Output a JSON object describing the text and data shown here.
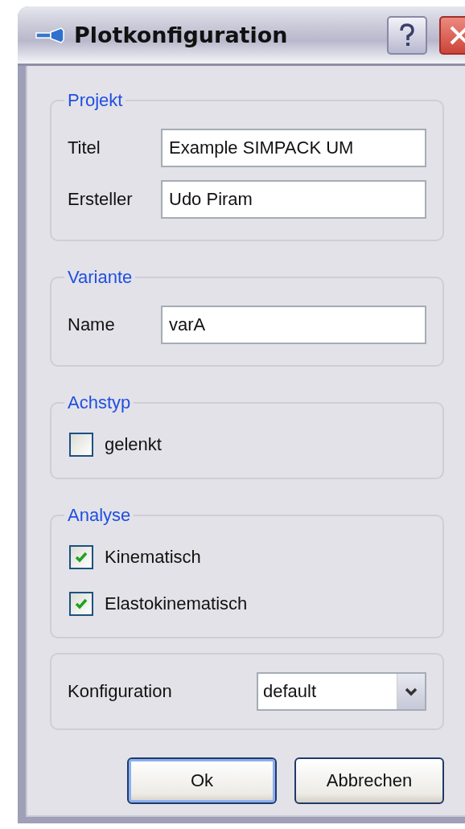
{
  "window": {
    "title": "Plotkonfiguration"
  },
  "groups": [
    {
      "kind": "fields",
      "legend": "Projekt",
      "fields": [
        {
          "label": "Titel",
          "value": "Example SIMPACK UM"
        },
        {
          "label": "Ersteller",
          "value": "Udo Piram"
        }
      ]
    },
    {
      "kind": "fields",
      "legend": "Variante",
      "fields": [
        {
          "label": "Name",
          "value": "varA"
        }
      ]
    },
    {
      "kind": "checks",
      "legend": "Achstyp",
      "checks": [
        {
          "label": "gelenkt",
          "checked": false
        }
      ]
    },
    {
      "kind": "checks",
      "legend": "Analyse",
      "checks": [
        {
          "label": "Kinematisch",
          "checked": true
        },
        {
          "label": "Elastokinematisch",
          "checked": true
        }
      ]
    },
    {
      "kind": "select",
      "label": "Konfiguration",
      "value": "default"
    }
  ],
  "buttons": [
    {
      "label": "Ok",
      "default": true
    },
    {
      "label": "Abbrechen",
      "default": false
    }
  ]
}
